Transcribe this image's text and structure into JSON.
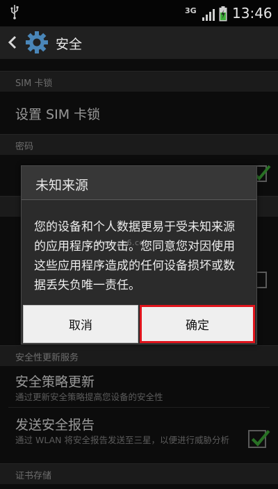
{
  "status_bar": {
    "network": "3G",
    "time": "13:46"
  },
  "action_bar": {
    "title": "安全"
  },
  "sections": {
    "sim_lock_header": "SIM 卡锁",
    "password_header": "密码",
    "security_update_header": "安全性更新服务",
    "credential_storage_header": "证书存储"
  },
  "items": {
    "setup_sim_lock": "设置 SIM 卡锁",
    "security_policy_update": {
      "title": "安全策略更新",
      "subtitle": "通过更新安全策略提高您设备的安全性"
    },
    "send_security_report": {
      "title": "发送安全报告",
      "subtitle": "通过 WLAN 将安全报告发送至三星，以便进行威胁分析"
    }
  },
  "dialog": {
    "title": "未知来源",
    "message": "您的设备和个人数据更易于受未知来源的应用程序的攻击。您同意您对因使用这些应用程序造成的任何设备损坏或数据丢失负唯一责任。",
    "cancel_label": "取消",
    "ok_label": "确定"
  },
  "watermark": "www.pc6.com",
  "colors": {
    "highlight": "#e0151d",
    "check_green": "#3fae3a"
  }
}
